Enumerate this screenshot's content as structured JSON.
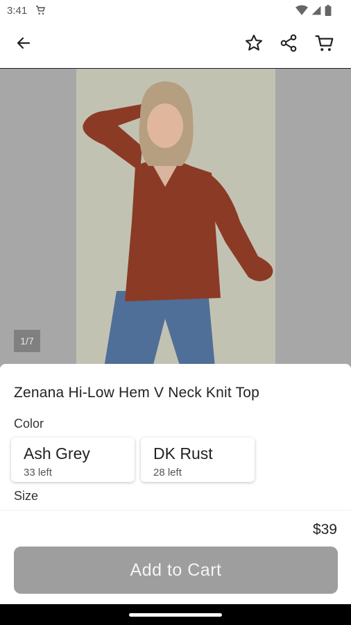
{
  "status_bar": {
    "time": "3:41"
  },
  "product": {
    "title": "Zenana Hi-Low Hem V Neck Knit Top",
    "image_indicator": "1/7",
    "price": "$39"
  },
  "color": {
    "label": "Color",
    "options": [
      {
        "name": "Ash Grey",
        "stock": "33 left"
      },
      {
        "name": "DK Rust",
        "stock": "28 left"
      }
    ]
  },
  "size": {
    "label": "Size"
  },
  "actions": {
    "add_to_cart": "Add to Cart"
  },
  "icons": {
    "back": "arrow-left-icon",
    "favorite": "star-icon",
    "share": "share-icon",
    "cart": "cart-icon"
  },
  "colors": {
    "sweater": "#8b3a26",
    "jeans": "#4f6f98",
    "button_disabled": "#9e9e9e"
  }
}
